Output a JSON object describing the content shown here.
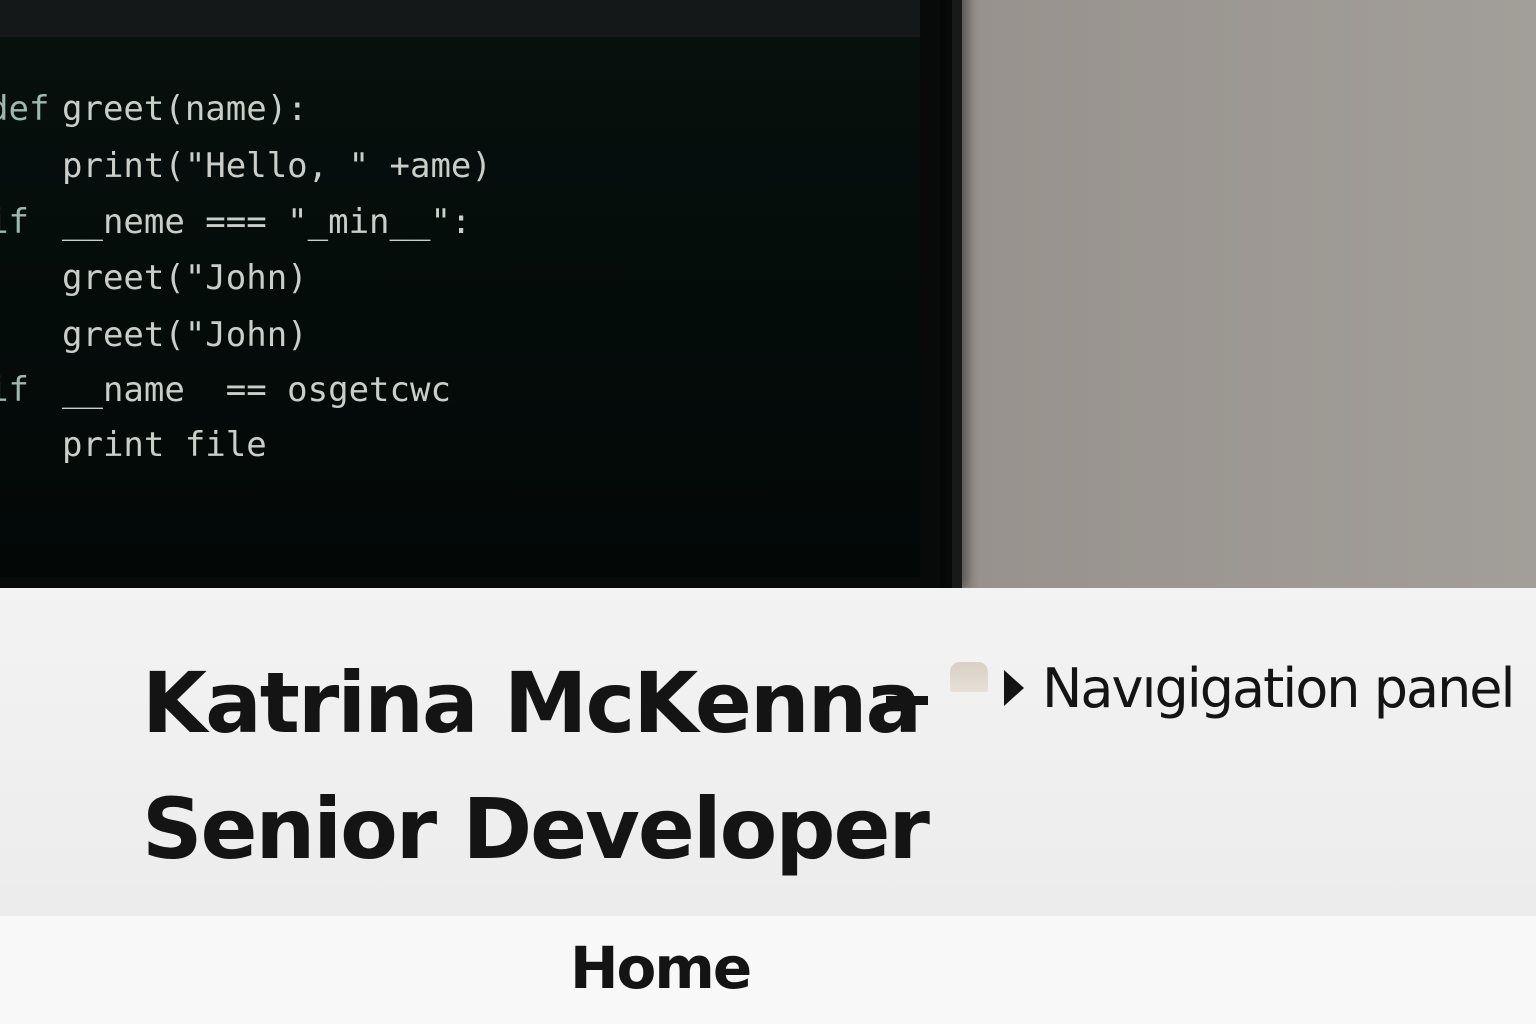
{
  "hero": {
    "code_lines": [
      {
        "keyword": "def",
        "text": "greet(name):"
      },
      {
        "keyword": "",
        "text": "print(\"Hello, \" +ame)"
      },
      {
        "keyword": "if",
        "text": "__neme === \"_min__\":"
      },
      {
        "keyword": "",
        "text": "greet(\"John)"
      },
      {
        "keyword": "",
        "text": "greet(\"John)"
      },
      {
        "keyword": "if",
        "text": "__name  == osgetcwc"
      },
      {
        "keyword": "",
        "text": "print file"
      }
    ]
  },
  "header": {
    "title_line1": "Katrina McKenna",
    "title_line2": "Senior Developer",
    "nav_toggle_label": "Navıgigation panel",
    "nav_toggle_icon": "caret-right-icon"
  },
  "nav": {
    "items": [
      {
        "label": "Home"
      }
    ]
  },
  "colors": {
    "title_text": "#141414",
    "band_background": "#efefef",
    "code_background": "#06100d",
    "code_keyword": "#9fb8ae",
    "code_text": "#c9cec9"
  }
}
